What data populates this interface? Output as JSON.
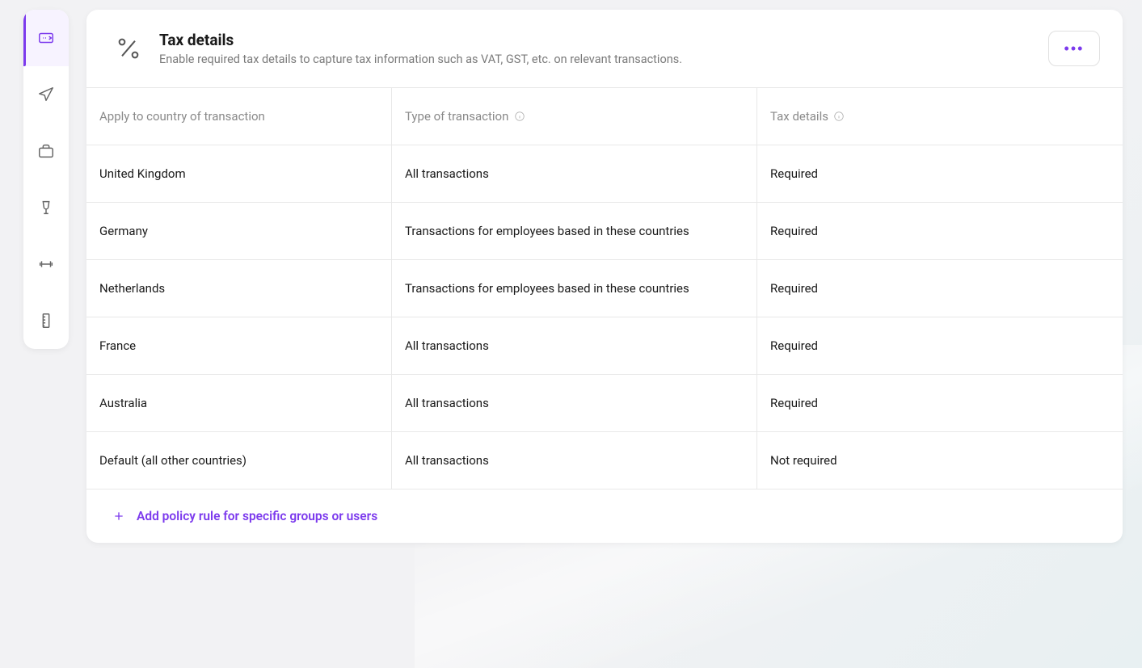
{
  "sidebar": {
    "items": [
      {
        "name": "expenses",
        "active": true
      },
      {
        "name": "travel",
        "active": false
      },
      {
        "name": "business",
        "active": false
      },
      {
        "name": "food",
        "active": false
      },
      {
        "name": "fitness",
        "active": false
      },
      {
        "name": "rules",
        "active": false
      }
    ]
  },
  "header": {
    "title": "Tax details",
    "subtitle": "Enable required tax details to capture tax information such as VAT, GST, etc. on relevant transactions."
  },
  "table": {
    "headers": {
      "country": "Apply to country of transaction",
      "type": "Type of transaction",
      "tax": "Tax details"
    },
    "rows": [
      {
        "country": "United Kingdom",
        "type": "All transactions",
        "tax": "Required"
      },
      {
        "country": "Germany",
        "type": "Transactions for employees based in these countries",
        "tax": "Required"
      },
      {
        "country": "Netherlands",
        "type": "Transactions for employees based in these countries",
        "tax": "Required"
      },
      {
        "country": "France",
        "type": "All transactions",
        "tax": "Required"
      },
      {
        "country": "Australia",
        "type": "All transactions",
        "tax": "Required"
      },
      {
        "country": "Default (all other countries)",
        "type": "All transactions",
        "tax": "Not required"
      }
    ]
  },
  "footer": {
    "add_policy_label": "Add policy rule for specific groups or users"
  }
}
